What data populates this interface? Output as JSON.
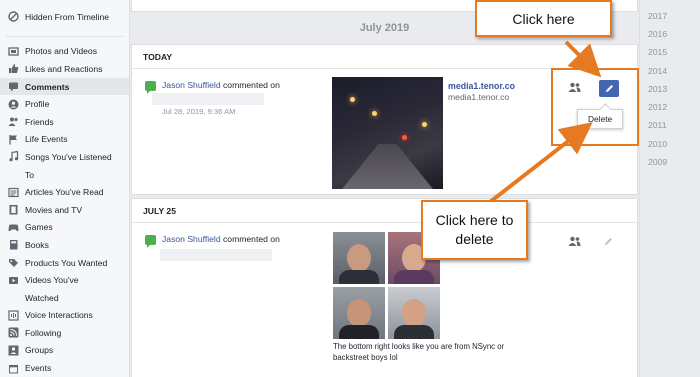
{
  "sidebar": {
    "items": [
      {
        "label": "Hidden From Timeline",
        "icon": "hidden-icon"
      },
      {
        "label": "Photos and Videos",
        "icon": "photos-icon"
      },
      {
        "label": "Likes and Reactions",
        "icon": "like-icon"
      },
      {
        "label": "Comments",
        "icon": "comment-icon",
        "active": true
      },
      {
        "label": "Profile",
        "icon": "profile-icon"
      },
      {
        "label": "Friends",
        "icon": "friends-icon"
      },
      {
        "label": "Life Events",
        "icon": "flag-icon"
      },
      {
        "label": "Songs You've Listened",
        "icon": "music-icon"
      },
      {
        "label": "To",
        "continuation": true
      },
      {
        "label": "Articles You've Read",
        "icon": "article-icon"
      },
      {
        "label": "Movies and TV",
        "icon": "film-icon"
      },
      {
        "label": "Games",
        "icon": "game-icon"
      },
      {
        "label": "Books",
        "icon": "book-icon"
      },
      {
        "label": "Products You Wanted",
        "icon": "product-icon"
      },
      {
        "label": "Videos You've",
        "icon": "video-icon"
      },
      {
        "label": "Watched",
        "continuation": true
      },
      {
        "label": "Voice Interactions",
        "icon": "voice-icon"
      },
      {
        "label": "Following",
        "icon": "rss-icon"
      },
      {
        "label": "Groups",
        "icon": "groups-icon"
      },
      {
        "label": "Events",
        "icon": "calendar-icon"
      }
    ]
  },
  "main": {
    "month": "July 2019",
    "sections": [
      {
        "header": "TODAY",
        "actor": "Jason Shuffield",
        "action": "commented on",
        "timestamp": "Jul 28, 2019, 9:36 AM",
        "link_title": "media1.tenor.co",
        "link_domain": "media1.tenor.co"
      },
      {
        "header": "JULY 25",
        "actor": "Jason Shuffield",
        "action": "commented on",
        "caption_line1": "The bottom right looks like you are from NSync or",
        "caption_line2": "backstreet boys lol"
      }
    ],
    "delete_label": "Delete"
  },
  "annotations": {
    "click_here": "Click here",
    "click_delete_line1": "Click here to",
    "click_delete_line2": "delete",
    "color": "#e57a22"
  },
  "years": [
    "2017",
    "2016",
    "2015",
    "2014",
    "2013",
    "2012",
    "2011",
    "2010",
    "2009"
  ],
  "colors": {
    "link": "#385898",
    "button": "#4267b2",
    "background": "#e9ebee"
  }
}
